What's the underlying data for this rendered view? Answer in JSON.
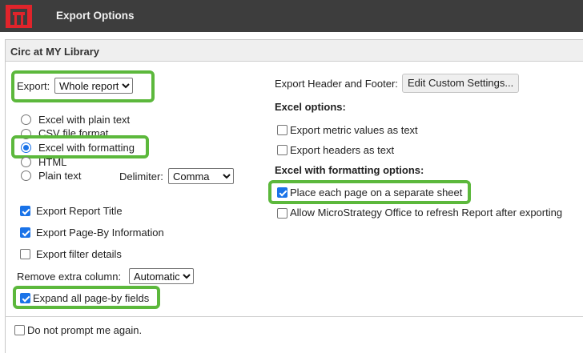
{
  "app": {
    "title": "Export Options",
    "logo_icon": "microstrategy-logo-icon",
    "logo_color": "#e0242b"
  },
  "panel": {
    "title": "Circ at MY Library"
  },
  "export": {
    "label": "Export:",
    "selected": "Whole report"
  },
  "formats": [
    {
      "label": "Excel with plain text",
      "checked": false
    },
    {
      "label": "CSV file format",
      "checked": false
    },
    {
      "label": "Excel with formatting",
      "checked": true
    },
    {
      "label": "HTML",
      "checked": false
    },
    {
      "label": "Plain text",
      "checked": false
    }
  ],
  "delimiter": {
    "label": "Delimiter:",
    "selected": "Comma"
  },
  "options": [
    {
      "label": "Export Report Title",
      "checked": true
    },
    {
      "label": "Export Page-By Information",
      "checked": true
    },
    {
      "label": "Export filter details",
      "checked": false
    }
  ],
  "remove_column": {
    "label": "Remove extra column:",
    "selected": "Automatic"
  },
  "expand_pageby": {
    "label": "Expand all page-by fields",
    "checked": true
  },
  "header_footer": {
    "label": "Export Header and Footer:",
    "button": "Edit Custom Settings..."
  },
  "excel_options": {
    "title": "Excel options:",
    "items": [
      {
        "label": "Export metric values as text",
        "checked": false
      },
      {
        "label": "Export headers as text",
        "checked": false
      }
    ]
  },
  "excel_formatting_options": {
    "title": "Excel with formatting options:",
    "items": [
      {
        "label": "Place each page on a separate sheet",
        "checked": true
      },
      {
        "label": "Allow MicroStrategy Office to refresh Report after exporting",
        "checked": false
      }
    ]
  },
  "do_not_prompt": {
    "label": "Do not prompt me again.",
    "checked": false
  },
  "colors": {
    "highlight": "#5cb83c",
    "accent": "#1a73e8",
    "topbar": "#3d3d3d"
  }
}
